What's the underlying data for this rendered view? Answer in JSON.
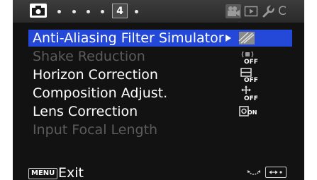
{
  "tabs": {
    "page_number": "4",
    "custom_label": "C"
  },
  "menu": {
    "items": [
      {
        "label": "Anti-Aliasing Filter Simulator",
        "state": "selected",
        "value_icon": "aa-filter-simulator-icon"
      },
      {
        "label": "Shake Reduction",
        "state": "disabled",
        "value_icon": "shake-reduction-off-icon"
      },
      {
        "label": "Horizon Correction",
        "state": "enabled",
        "value_icon": "horizon-correction-off-icon"
      },
      {
        "label": "Composition Adjust.",
        "state": "enabled",
        "value_icon": "composition-adjust-off-icon"
      },
      {
        "label": "Lens Correction",
        "state": "enabled",
        "value_icon": "lens-correction-on-icon"
      },
      {
        "label": "Input Focal Length",
        "state": "disabled",
        "value_icon": ""
      }
    ],
    "icon_badges": {
      "off": "OFF",
      "on": "ON"
    }
  },
  "bottom": {
    "menu_button_label": "MENU",
    "exit_label": "Exit"
  },
  "colors": {
    "selection": "#2448d8",
    "background": "#121212",
    "disabled_text": "#5c5c5c"
  }
}
